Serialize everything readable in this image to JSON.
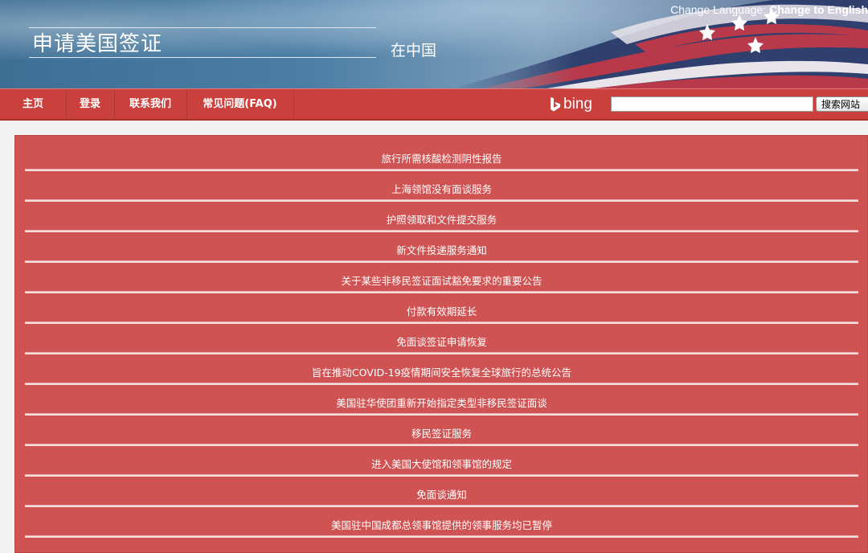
{
  "header": {
    "title": "申请美国签证",
    "subtitle": "在中国",
    "change_language_label": "Change Language:",
    "change_language_link": "Change to English"
  },
  "nav": {
    "items": [
      {
        "label": "主页"
      },
      {
        "label": "登录"
      },
      {
        "label": "联系我们"
      },
      {
        "label": "常见问题(FAQ)"
      }
    ],
    "bing_text": "bing",
    "search_value": "",
    "search_button": "搜索网站"
  },
  "notices": [
    {
      "label": "旅行所需核酸检测阴性报告"
    },
    {
      "label": "上海领馆没有面谈服务"
    },
    {
      "label": "护照领取和文件提交服务"
    },
    {
      "label": "新文件投递服务通知"
    },
    {
      "label": "关于某些非移民签证面试豁免要求的重要公告"
    },
    {
      "label": "付款有效期延长"
    },
    {
      "label": "免面谈签证申请恢复"
    },
    {
      "label": "旨在推动COVID-19疫情期间安全恢复全球旅行的总统公告"
    },
    {
      "label": "美国驻华使团重新开始指定类型非移民签证面谈"
    },
    {
      "label": "移民签证服务"
    },
    {
      "label": "进入美国大使馆和领事馆的规定"
    },
    {
      "label": "免面谈通知"
    },
    {
      "label": "美国驻中国成都总领事馆提供的领事服务均已暂停"
    }
  ],
  "colors": {
    "nav_bg": "#c9403d",
    "panel_bg": "#cf5353",
    "header_bg": "#4a7ea5"
  }
}
